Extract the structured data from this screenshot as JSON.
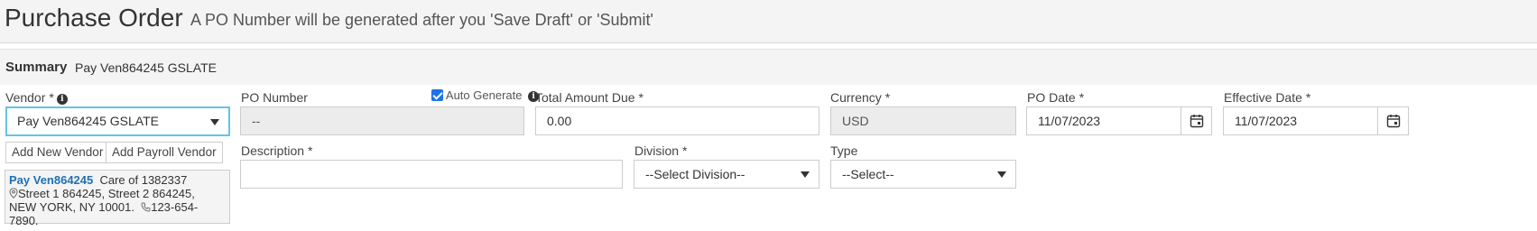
{
  "header": {
    "title": "Purchase Order",
    "subtitle": "A PO Number will be generated after you 'Save Draft' or 'Submit'"
  },
  "summary": {
    "label": "Summary",
    "value": "Pay Ven864245 GSLATE"
  },
  "vendor": {
    "label": "Vendor",
    "required": "*",
    "selected": "Pay Ven864245 GSLATE",
    "add_new_label": "Add New Vendor",
    "add_payroll_label": "Add Payroll Vendor",
    "card": {
      "name": "Pay Ven864245",
      "care_of": "Care of 1382337",
      "address_line": "Street 1 864245,  Street 2 864245,",
      "city_line": "NEW YORK,  NY  10001.",
      "phone": "123-654-7890."
    }
  },
  "po_number": {
    "label": "PO Number",
    "value": "--",
    "auto_generate_label": "Auto Generate",
    "auto_generate_checked": true
  },
  "total_amount_due": {
    "label": "Total Amount Due",
    "required": "*",
    "value": "0.00"
  },
  "currency": {
    "label": "Currency",
    "required": "*",
    "value": "USD"
  },
  "po_date": {
    "label": "PO Date",
    "required": "*",
    "value": "11/07/2023"
  },
  "effective_date": {
    "label": "Effective Date",
    "required": "*",
    "value": "11/07/2023"
  },
  "description": {
    "label": "Description",
    "required": "*",
    "value": ""
  },
  "division": {
    "label": "Division",
    "required": "*",
    "selected": "--Select Division--"
  },
  "type": {
    "label": "Type",
    "selected": "--Select--"
  },
  "icons": {
    "info": "info-icon",
    "calendar": "calendar-icon",
    "location": "map-pin-icon",
    "phone": "phone-icon",
    "dropdown": "chevron-down-icon"
  },
  "colors": {
    "focus_border": "#66c2e8",
    "vendor_link": "#1f6fb5",
    "checkbox": "#1a73e8",
    "header_bg": "#f4f4f4"
  }
}
